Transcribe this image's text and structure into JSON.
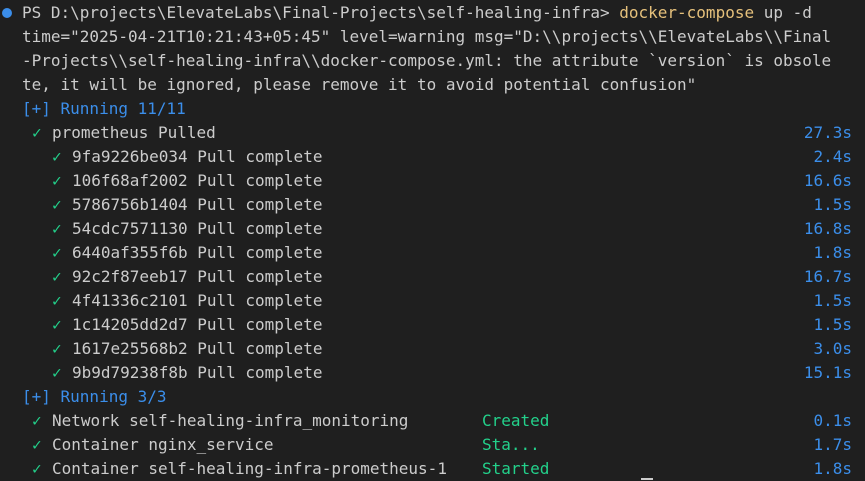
{
  "prompt": {
    "path": "PS D:\\projects\\ElevateLabs\\Final-Projects\\self-healing-infra> ",
    "command": "docker-compose",
    "args": " up -d"
  },
  "warning": {
    "line1": "time=\"2025-04-21T10:21:43+05:45\" level=warning msg=\"D:\\\\projects\\\\ElevateLabs\\\\Final",
    "line2": "-Projects\\\\self-healing-infra\\\\docker-compose.yml: the attribute `version` is obsole",
    "line3": "te, it will be ignored, please remove it to avoid potential confusion\""
  },
  "running1": "[+] Running 11/11",
  "pull_parent": {
    "check": "✓",
    "label": "prometheus Pulled",
    "time": "27.3s"
  },
  "pulls": [
    {
      "check": "✓",
      "label": "9fa9226be034 Pull complete",
      "time": "2.4s"
    },
    {
      "check": "✓",
      "label": "106f68af2002 Pull complete",
      "time": "16.6s"
    },
    {
      "check": "✓",
      "label": "5786756b1404 Pull complete",
      "time": "1.5s"
    },
    {
      "check": "✓",
      "label": "54cdc7571130 Pull complete",
      "time": "16.8s"
    },
    {
      "check": "✓",
      "label": "6440af355f6b Pull complete",
      "time": "1.8s"
    },
    {
      "check": "✓",
      "label": "92c2f87eeb17 Pull complete",
      "time": "16.7s"
    },
    {
      "check": "✓",
      "label": "4f41336c2101 Pull complete",
      "time": "1.5s"
    },
    {
      "check": "✓",
      "label": "1c14205dd2d7 Pull complete",
      "time": "1.5s"
    },
    {
      "check": "✓",
      "label": "1617e25568b2 Pull complete",
      "time": "3.0s"
    },
    {
      "check": "✓",
      "label": "9b9d79238f8b Pull complete",
      "time": "15.1s"
    }
  ],
  "running2": "[+] Running 3/3",
  "resources": [
    {
      "check": "✓",
      "label": "Network self-healing-infra_monitoring",
      "status": "Created",
      "time": "0.1s"
    },
    {
      "check": "✓",
      "label": "Container nginx_service",
      "status": "Sta...",
      "time": "1.7s"
    },
    {
      "check": "✓",
      "label": "Container self-healing-infra-prometheus-1",
      "status": "Started",
      "time": "1.8s"
    }
  ],
  "colors": {
    "background": "#1f1f1f",
    "text": "#cccccc",
    "command": "#e5c07b",
    "accent": "#3b8eea",
    "success": "#23d18b"
  }
}
